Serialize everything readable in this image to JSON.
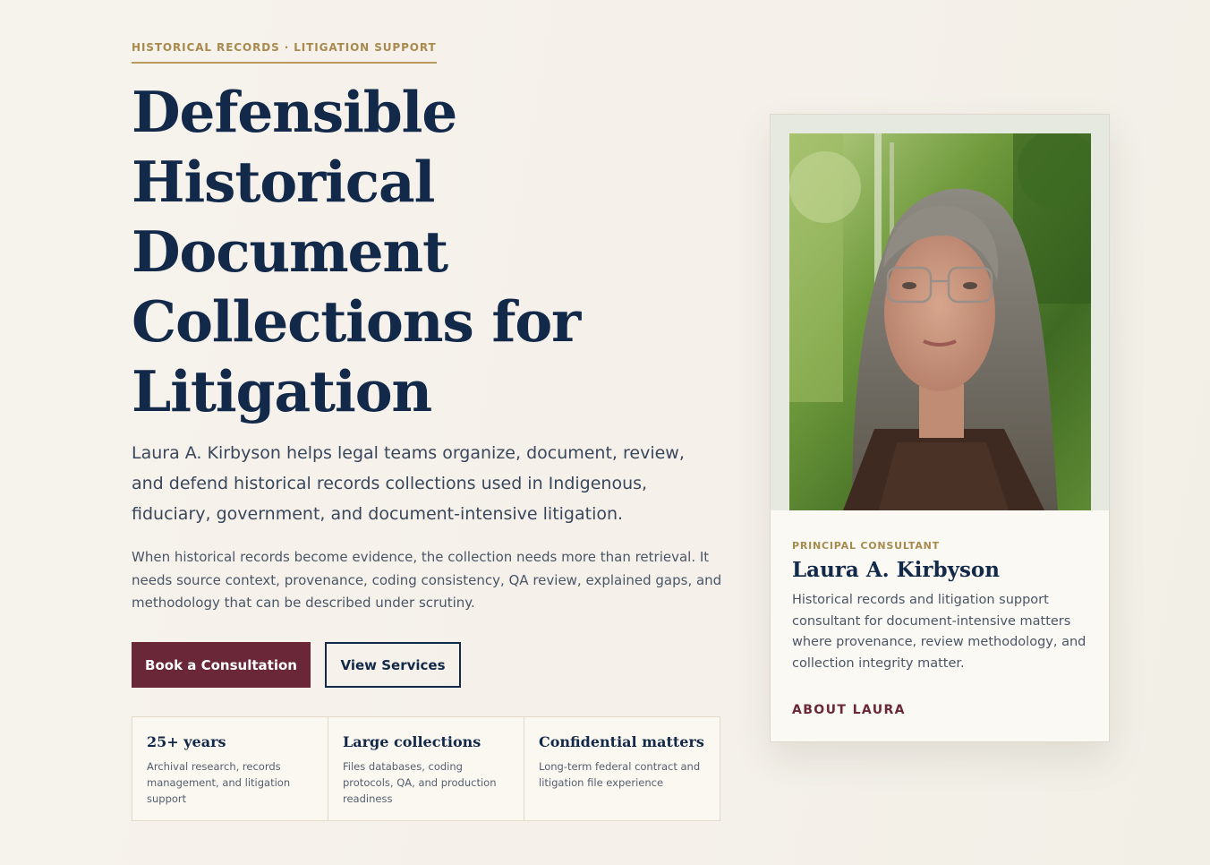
{
  "hero": {
    "eyebrow": "HISTORICAL RECORDS · LITIGATION SUPPORT",
    "headline": "Defensible Historical Document Collections for Litigation",
    "lede": "Laura A. Kirbyson helps legal teams organize, document, review, and defend historical records collections used in Indigenous, fiduciary, government, and document-intensive litigation.",
    "body": "When historical records become evidence, the collection needs more than retrieval. It needs source context, provenance, coding consistency, QA review, explained gaps, and methodology that can be described under scrutiny.",
    "primary_cta": "Book a Consultation",
    "secondary_cta": "View Services"
  },
  "stats": [
    {
      "title": "25+ years",
      "desc": "Archival research, records management, and litigation support"
    },
    {
      "title": "Large collections",
      "desc": "Files databases, coding protocols, QA, and production readiness"
    },
    {
      "title": "Confidential matters",
      "desc": "Long-term federal contract and litigation file experience"
    }
  ],
  "profile": {
    "role": "PRINCIPAL CONSULTANT",
    "name": "Laura A. Kirbyson",
    "bio": "Historical records and litigation support consultant for document-intensive matters where provenance, review methodology, and collection integrity matter.",
    "link": "ABOUT LAURA",
    "photo_icon": "portrait-photo"
  },
  "colors": {
    "navy": "#13294a",
    "burgundy": "#6a2737",
    "gold": "#a88a4e",
    "background": "#f6f2ec"
  }
}
